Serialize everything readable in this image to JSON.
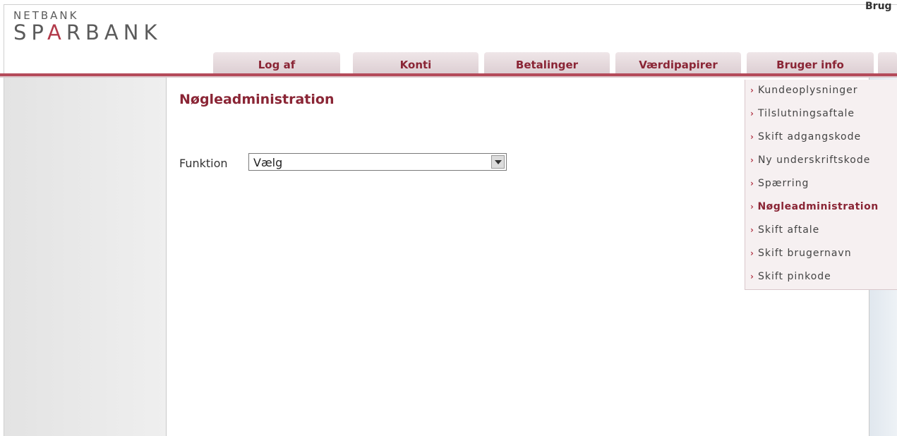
{
  "header": {
    "logo_top": "NETBANK",
    "logo_bottom_pre": "SP",
    "logo_bottom_a": "A",
    "logo_bottom_post": "RBANK",
    "user_label": "Brug"
  },
  "nav": {
    "tabs": [
      {
        "label": "Log af"
      },
      {
        "label": "Konti"
      },
      {
        "label": "Betalinger"
      },
      {
        "label": "Værdipapirer"
      },
      {
        "label": "Bruger info",
        "active": true
      }
    ]
  },
  "main": {
    "title": "Nøgleadministration",
    "function_label": "Funktion",
    "function_select_value": "Vælg"
  },
  "submenu": {
    "items": [
      {
        "label": "Kundeoplysninger"
      },
      {
        "label": "Tilslutningsaftale"
      },
      {
        "label": "Skift adgangskode"
      },
      {
        "label": "Ny underskriftskode"
      },
      {
        "label": "Spærring"
      },
      {
        "label": "Nøgleadministration",
        "active": true
      },
      {
        "label": "Skift aftale"
      },
      {
        "label": "Skift brugernavn"
      },
      {
        "label": "Skift pinkode"
      }
    ],
    "arrow_glyph": "›"
  },
  "colors": {
    "accent": "#8a2535",
    "nav_bar": "#b44a5a"
  }
}
